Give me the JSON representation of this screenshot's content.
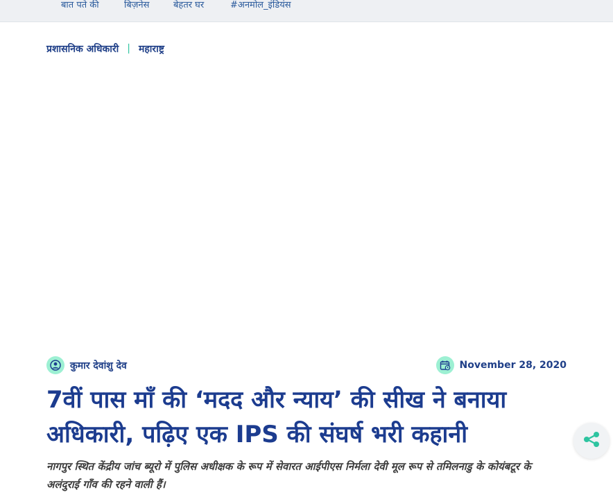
{
  "topnav": {
    "items": [
      "बात पते की",
      "बिज़नेस",
      "बेहतर घर",
      "#अनमोल_इंडियंस"
    ]
  },
  "breadcrumb": {
    "items": [
      "प्रशासनिक अधिकारी",
      "महाराष्ट्र"
    ],
    "separator": "|"
  },
  "article": {
    "author": "कुमार देवांशु देव",
    "date": "November 28, 2020",
    "title": "7वीं पास माँ की ‘मदद और न्याय’ की सीख ने बनाया अधिकारी, पढ़िए एक IPS की संघर्ष भरी कहानी",
    "summary": "नागपुर स्थित केंद्रीय जांच ब्यूरो में पुलिस अधीक्षक के रूप में सेवारत आईपीएस निर्मला देवी मूल रूप से तमिलनाडु के कोयंबटूर के अलंदुराई गाँव की रहने वाली हैं।"
  },
  "icons": {
    "author": "user-circle-icon",
    "date": "calendar-icon",
    "share": "share-icon"
  },
  "colors": {
    "brand_blue": "#1c3c8f",
    "accent_green": "#2ec4a0",
    "icon_bg": "#9df0d3"
  }
}
